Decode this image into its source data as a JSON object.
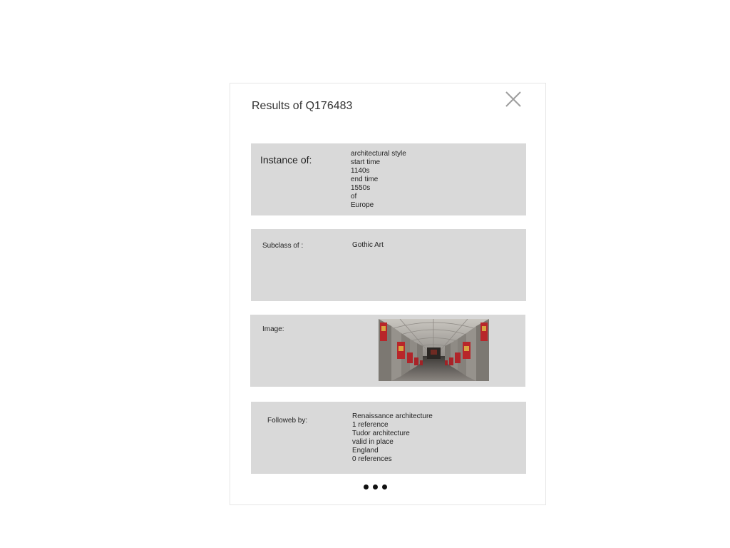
{
  "dialog": {
    "title": "Results of Q176483",
    "close_icon": "close-icon",
    "more_icon": "more-dots-icon"
  },
  "instance_of": {
    "label": "Instance of:",
    "values": [
      "architectural style",
      "start time",
      "1140s",
      "end time",
      "1550s",
      "of",
      "Europe"
    ]
  },
  "subclass_of": {
    "label": "Subclass of :",
    "values": [
      "Gothic Art"
    ]
  },
  "image": {
    "label": "Image:",
    "description": "cathedral-nave-photo"
  },
  "followed_by": {
    "label": "Followeb by:",
    "values": [
      "Renaissance architecture",
      "1 reference",
      "Tudor architecture",
      "valid in place",
      "England",
      "0 references"
    ]
  },
  "colors": {
    "panel": "#d9d9d9",
    "border": "#e6e6e6",
    "close": "#9e9e9e"
  }
}
